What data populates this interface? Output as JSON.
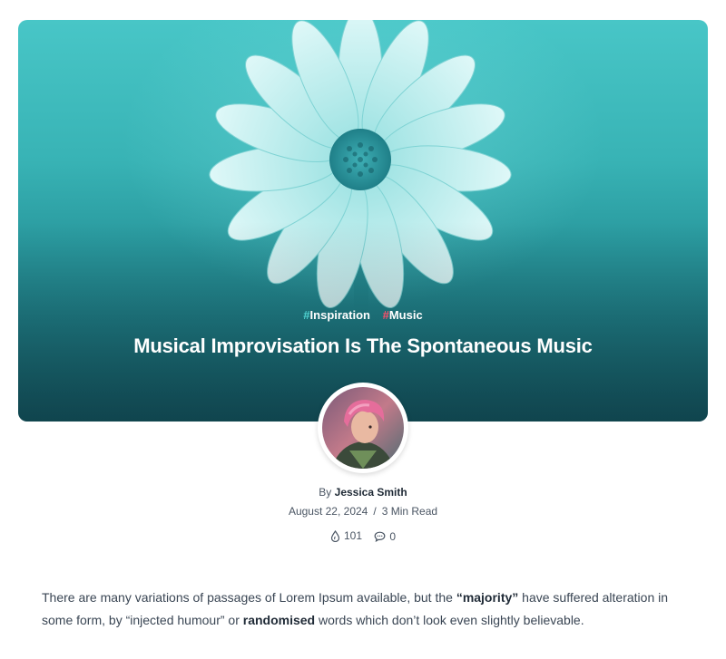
{
  "article": {
    "tags": [
      {
        "hash": "#",
        "label": "Inspiration",
        "hash_color": "#4fd2d0"
      },
      {
        "hash": "#",
        "label": "Music",
        "hash_color": "#ff4f6a"
      }
    ],
    "title": "Musical Improvisation Is The Spontaneous Music",
    "byline_prefix": "By",
    "author": "Jessica Smith",
    "date": "August 22, 2024",
    "separator": "/",
    "read_time": "3 Min Read",
    "views": "101",
    "comments": "0",
    "icons": {
      "views": "drop-icon",
      "comments": "comment-icon"
    },
    "body": {
      "part1": "There are many variations of passages of Lorem Ipsum available, but the ",
      "bold1": "“majority”",
      "part2": " have suffered alteration in some form, by “injected humour” or ",
      "bold2": "randomised",
      "part3": " words which don’t look even slightly believable."
    }
  },
  "colors": {
    "hero_top": "#48c6c7",
    "hero_bottom": "#155c66",
    "text": "#1f2a36",
    "muted": "#4a5563"
  }
}
